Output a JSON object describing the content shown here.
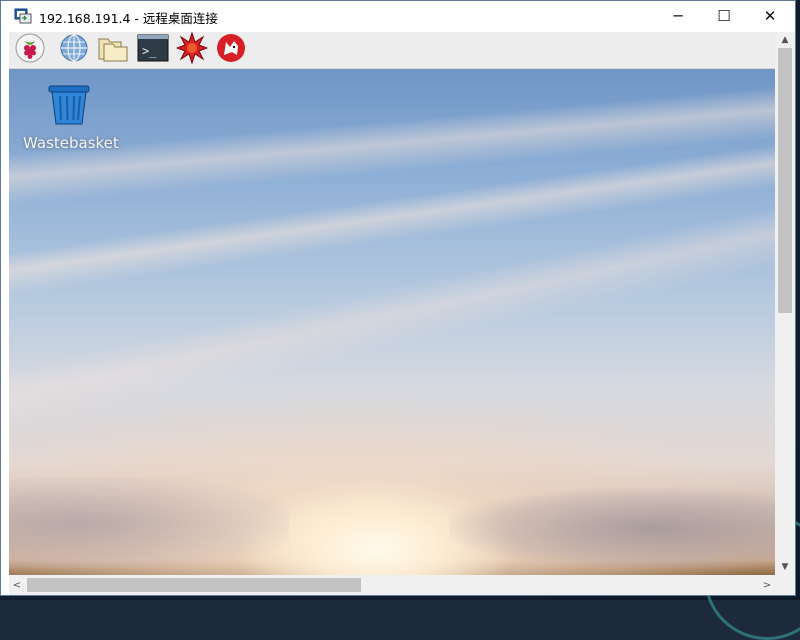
{
  "window": {
    "title": "192.168.191.4 - 远程桌面连接",
    "icon": "remote-desktop-icon",
    "controls": {
      "minimize": "─",
      "maximize": "☐",
      "close": "✕"
    }
  },
  "panel": {
    "launchers": [
      {
        "name": "raspberry-menu",
        "icon": "raspberry-icon"
      },
      {
        "name": "web-browser",
        "icon": "globe-icon"
      },
      {
        "name": "file-manager",
        "icon": "folder-icon"
      },
      {
        "name": "terminal",
        "icon": "terminal-icon"
      },
      {
        "name": "mathematica",
        "icon": "starburst-icon"
      },
      {
        "name": "wolfram",
        "icon": "wolf-icon"
      }
    ],
    "terminal_prompt": ">_"
  },
  "desktop": {
    "icons": [
      {
        "label": "Wastebasket",
        "icon": "trash-icon"
      }
    ]
  },
  "scrollbars": {
    "up_arrow": "▲",
    "down_arrow": "▼",
    "left_arrow": "<",
    "right_arrow": ">"
  },
  "colors": {
    "panel": "#ededed",
    "sky_top": "#6f95c6",
    "horizon": "#8e6a43"
  }
}
